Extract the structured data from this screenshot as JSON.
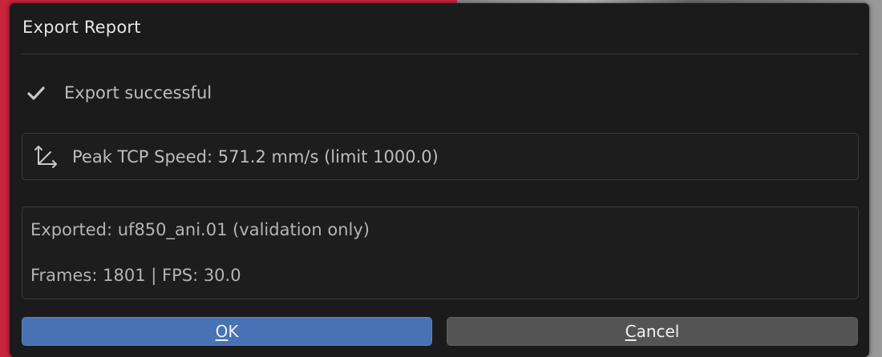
{
  "dialog": {
    "title": "Export Report",
    "status": {
      "icon": "check-icon",
      "text": "Export successful"
    },
    "speed": {
      "icon": "axes-icon",
      "text": "Peak TCP Speed: 571.2 mm/s (limit 1000.0)"
    },
    "details": {
      "line1": "Exported: uf850_ani.01 (validation only)",
      "line2": "Frames: 1801 | FPS: 30.0"
    },
    "buttons": {
      "ok_mnemonic": "O",
      "ok_rest": "K",
      "cancel_mnemonic": "C",
      "cancel_rest": "ancel"
    }
  },
  "colors": {
    "ok_button": "#4772b3",
    "cancel_button": "#545454",
    "dialog_bg": "#1b1b1b",
    "backdrop_left": "#c8243c"
  }
}
